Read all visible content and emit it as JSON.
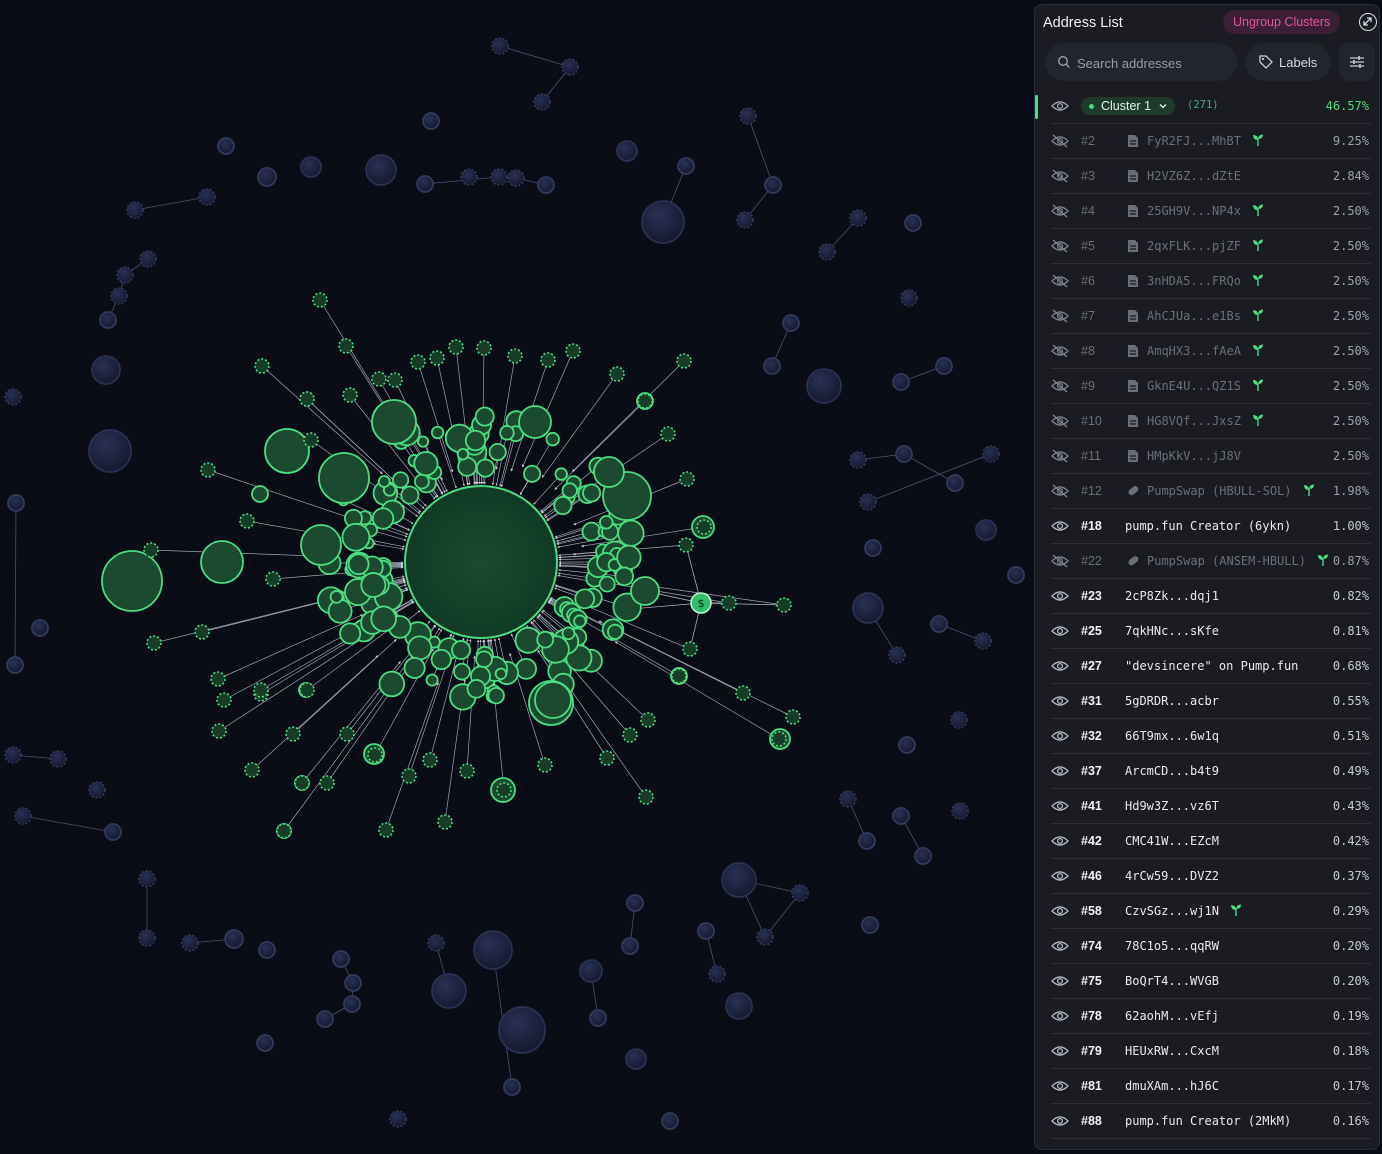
{
  "panel": {
    "title": "Address List",
    "ungroup_label": "Ungroup Clusters",
    "search_placeholder": "Search addresses",
    "labels_label": "Labels",
    "cluster": {
      "label": "Cluster 1",
      "count": "(271)",
      "percent": "46.57%"
    },
    "rows": [
      {
        "rank": "#2",
        "address": "FyR2FJ...MhBT",
        "percent": "9.25%",
        "hidden": true,
        "icon": "doc",
        "sprout": true
      },
      {
        "rank": "#3",
        "address": "H2VZ6Z...dZtE",
        "percent": "2.84%",
        "hidden": true,
        "icon": "doc",
        "sprout": false
      },
      {
        "rank": "#4",
        "address": "25GH9V...NP4x",
        "percent": "2.50%",
        "hidden": true,
        "icon": "doc",
        "sprout": true
      },
      {
        "rank": "#5",
        "address": "2qxFLK...pjZF",
        "percent": "2.50%",
        "hidden": true,
        "icon": "doc",
        "sprout": true
      },
      {
        "rank": "#6",
        "address": "3nHDA5...FRQo",
        "percent": "2.50%",
        "hidden": true,
        "icon": "doc",
        "sprout": true
      },
      {
        "rank": "#7",
        "address": "AhCJUa...e1Bs",
        "percent": "2.50%",
        "hidden": true,
        "icon": "doc",
        "sprout": true
      },
      {
        "rank": "#8",
        "address": "AmqHX3...fAeA",
        "percent": "2.50%",
        "hidden": true,
        "icon": "doc",
        "sprout": true
      },
      {
        "rank": "#9",
        "address": "GknE4U...QZ1S",
        "percent": "2.50%",
        "hidden": true,
        "icon": "doc",
        "sprout": true
      },
      {
        "rank": "#10",
        "address": "HG8VQf...JxsZ",
        "percent": "2.50%",
        "hidden": true,
        "icon": "doc",
        "sprout": true
      },
      {
        "rank": "#11",
        "address": "HMpKkV...jJ8V",
        "percent": "2.50%",
        "hidden": true,
        "icon": "doc",
        "sprout": false
      },
      {
        "rank": "#12",
        "address": "PumpSwap (HBULL-SOL)",
        "percent": "1.98%",
        "hidden": true,
        "icon": "pill",
        "sprout": true
      },
      {
        "rank": "#18",
        "address": "pump.fun Creator (6ykn)",
        "percent": "1.00%",
        "hidden": false,
        "icon": "",
        "sprout": false
      },
      {
        "rank": "#22",
        "address": "PumpSwap (ANSEM-HBULL)",
        "percent": "0.87%",
        "hidden": true,
        "icon": "pill",
        "sprout": true
      },
      {
        "rank": "#23",
        "address": "2cP8Zk...dqj1",
        "percent": "0.82%",
        "hidden": false,
        "icon": "",
        "sprout": false
      },
      {
        "rank": "#25",
        "address": "7qkHNc...sKfe",
        "percent": "0.81%",
        "hidden": false,
        "icon": "",
        "sprout": false
      },
      {
        "rank": "#27",
        "address": "\"devsincere\" on Pump.fun",
        "percent": "0.68%",
        "hidden": false,
        "icon": "",
        "sprout": false
      },
      {
        "rank": "#31",
        "address": "5gDRDR...acbr",
        "percent": "0.55%",
        "hidden": false,
        "icon": "",
        "sprout": false
      },
      {
        "rank": "#32",
        "address": "66T9mx...6w1q",
        "percent": "0.51%",
        "hidden": false,
        "icon": "",
        "sprout": false
      },
      {
        "rank": "#37",
        "address": "ArcmCD...b4t9",
        "percent": "0.49%",
        "hidden": false,
        "icon": "",
        "sprout": false
      },
      {
        "rank": "#41",
        "address": "Hd9w3Z...vz6T",
        "percent": "0.43%",
        "hidden": false,
        "icon": "",
        "sprout": false
      },
      {
        "rank": "#42",
        "address": "CMC41W...EZcM",
        "percent": "0.42%",
        "hidden": false,
        "icon": "",
        "sprout": false
      },
      {
        "rank": "#46",
        "address": "4rCw59...DVZ2",
        "percent": "0.37%",
        "hidden": false,
        "icon": "",
        "sprout": false
      },
      {
        "rank": "#58",
        "address": "CzvSGz...wj1N",
        "percent": "0.29%",
        "hidden": false,
        "icon": "",
        "sprout": true
      },
      {
        "rank": "#74",
        "address": "78C1o5...qqRW",
        "percent": "0.20%",
        "hidden": false,
        "icon": "",
        "sprout": false
      },
      {
        "rank": "#75",
        "address": "BoQrT4...WVGB",
        "percent": "0.20%",
        "hidden": false,
        "icon": "",
        "sprout": false
      },
      {
        "rank": "#78",
        "address": "62aohM...vEfj",
        "percent": "0.19%",
        "hidden": false,
        "icon": "",
        "sprout": false
      },
      {
        "rank": "#79",
        "address": "HEUxRW...CxcM",
        "percent": "0.18%",
        "hidden": false,
        "icon": "",
        "sprout": false
      },
      {
        "rank": "#81",
        "address": "dmuXAm...hJ6C",
        "percent": "0.17%",
        "hidden": false,
        "icon": "",
        "sprout": false
      },
      {
        "rank": "#88",
        "address": "pump.fun Creator (2MkM)",
        "percent": "0.16%",
        "hidden": false,
        "icon": "",
        "sprout": false
      }
    ]
  },
  "colors": {
    "background": "#0b0d16",
    "cluster_green": "#4ade80",
    "cluster_fill": "#14402a",
    "inactive_node": "#1e2440",
    "ungroup_pink": "#e0569e"
  }
}
